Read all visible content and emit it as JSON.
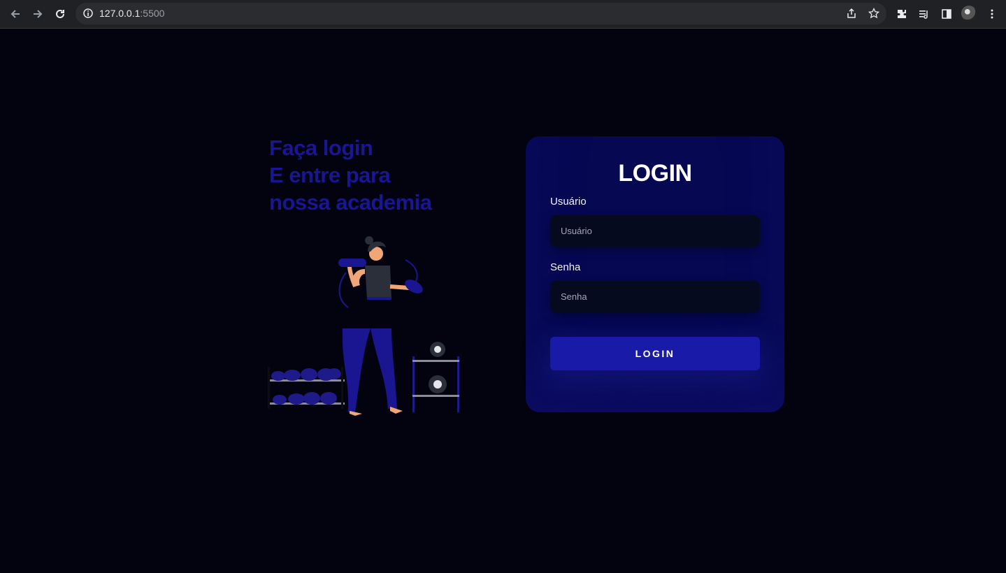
{
  "browser": {
    "url_host": "127.0.0.1",
    "url_port": ":5500"
  },
  "hero": {
    "line1": "Faça login",
    "line2": "E entre para",
    "line3": "nossa academia"
  },
  "login": {
    "title": "LOGIN",
    "username_label": "Usuário",
    "username_placeholder": "Usuário",
    "password_label": "Senha",
    "password_placeholder": "Senha",
    "submit_label": "LOGIN"
  },
  "colors": {
    "background": "#03020f",
    "accent": "#1a1aa8",
    "card": "#060852",
    "headline": "#1a1590"
  }
}
